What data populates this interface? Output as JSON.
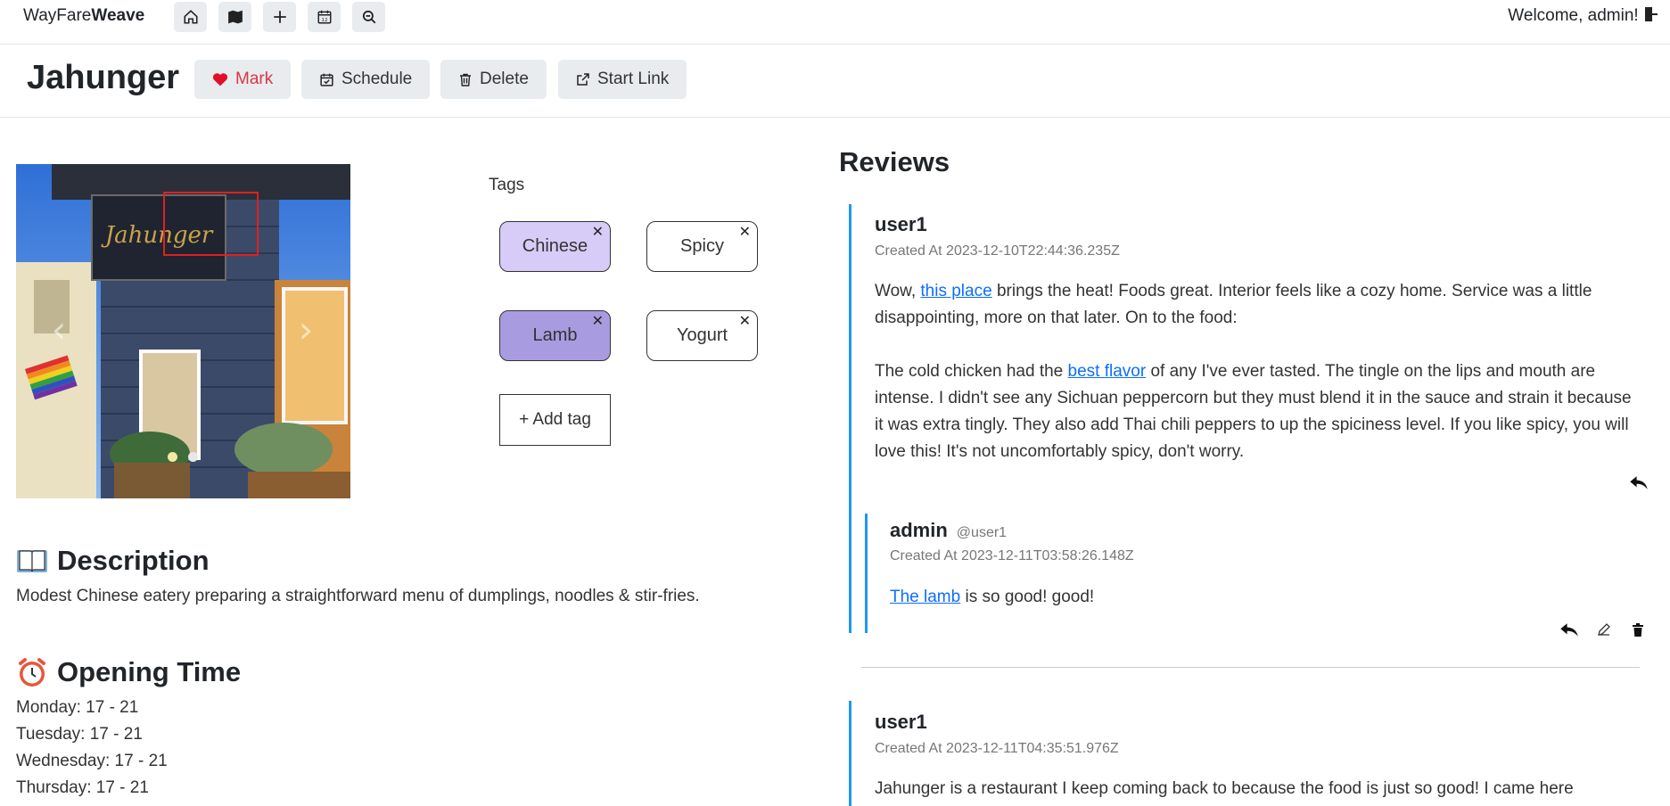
{
  "nav": {
    "brand_light": "WayFare",
    "brand_bold": "Weave",
    "welcome": "Welcome, admin!",
    "icons": [
      "home-icon",
      "map-icon",
      "plus-icon",
      "calendar-icon",
      "search-icon",
      "logout-icon"
    ]
  },
  "header": {
    "title": "Jahunger",
    "buttons": {
      "mark": "Mark",
      "schedule": "Schedule",
      "delete": "Delete",
      "start_link": "Start Link"
    }
  },
  "carousel": {
    "slides": 2,
    "active": 0
  },
  "tags": {
    "label": "Tags",
    "items": [
      "Chinese",
      "Spicy",
      "Lamb",
      "Yogurt"
    ],
    "add_label": "+ Add tag"
  },
  "description": {
    "heading": "Description",
    "text": "Modest Chinese eatery preparing a straightforward menu of dumplings, noodles & stir-fries."
  },
  "opening": {
    "heading": "Opening Time",
    "hours": [
      "Monday: 17 - 21",
      "Tuesday: 17 - 21",
      "Wednesday: 17 - 21",
      "Thursday: 17 - 21"
    ]
  },
  "reviews": {
    "heading": "Reviews",
    "items": [
      {
        "user": "user1",
        "created": "Created At 2023-12-10T22:44:36.235Z",
        "p1_a": "Wow, ",
        "p1_link": "this place",
        "p1_b": " brings the heat! Foods great. Interior feels like a cozy home. Service was a little disappointing, more on that later. On to the food:",
        "p2_a": "The cold chicken had the ",
        "p2_link": "best flavor",
        "p2_b": " of any I've ever tasted. The tingle on the lips and mouth are intense. I didn't see any Sichuan peppercorn but they must blend it in the sauce and strain it because it was extra tingly. They also add Thai chili peppers to up the spiciness level. If you like spicy, you will love this! It's not uncomfortably spicy, don't worry.",
        "reply": {
          "user": "admin",
          "mention": "@user1",
          "created": "Created At 2023-12-11T03:58:26.148Z",
          "link": "The lamb",
          "text": " is so good! good!"
        }
      },
      {
        "user": "user1",
        "created": "Created At 2023-12-11T04:35:51.976Z",
        "text": "Jahunger is a restaurant I keep coming back to because the food is just so good! I came here"
      }
    ]
  },
  "colors": {
    "accent": "#2196f3",
    "mark": "#dc3545",
    "tag_purple_light": "#d6ccf7",
    "tag_purple": "#a99be0",
    "link": "#0d6efd"
  }
}
